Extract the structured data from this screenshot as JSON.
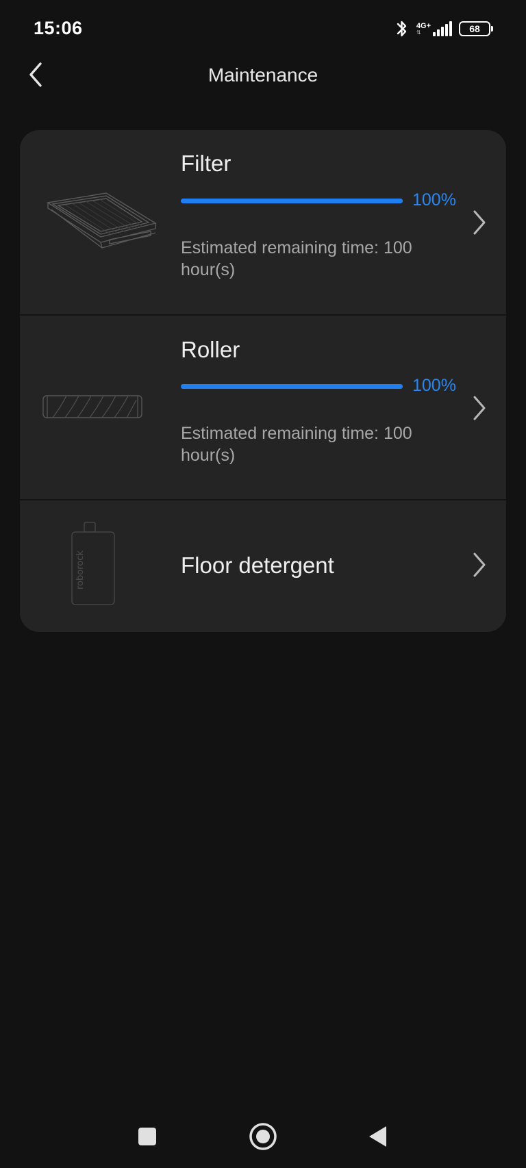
{
  "status_bar": {
    "time": "15:06",
    "network_type": "4G+",
    "network_arrows": "⇅",
    "battery_level": "68",
    "icons": [
      "bluetooth-icon",
      "signal-icon",
      "battery-icon"
    ]
  },
  "header": {
    "title": "Maintenance",
    "back_icon": "chevron-left-icon"
  },
  "colors": {
    "background": "#121212",
    "card": "#242424",
    "accent": "#1f7ff0",
    "text_primary": "#efefef",
    "text_secondary": "#a8a8a8"
  },
  "items": [
    {
      "title": "Filter",
      "progress_percent": 100,
      "progress_label": "100%",
      "remaining_text": "Estimated remaining time: 100 hour(s)",
      "image_icon": "filter-icon"
    },
    {
      "title": "Roller",
      "progress_percent": 100,
      "progress_label": "100%",
      "remaining_text": "Estimated remaining time: 100 hour(s)",
      "image_icon": "roller-brush-icon"
    },
    {
      "title": "Floor detergent",
      "image_icon": "detergent-bottle-icon",
      "brand_text": "roborock"
    }
  ],
  "nav_bar": {
    "icons": [
      "recents-square-icon",
      "home-circle-icon",
      "back-triangle-icon"
    ]
  }
}
